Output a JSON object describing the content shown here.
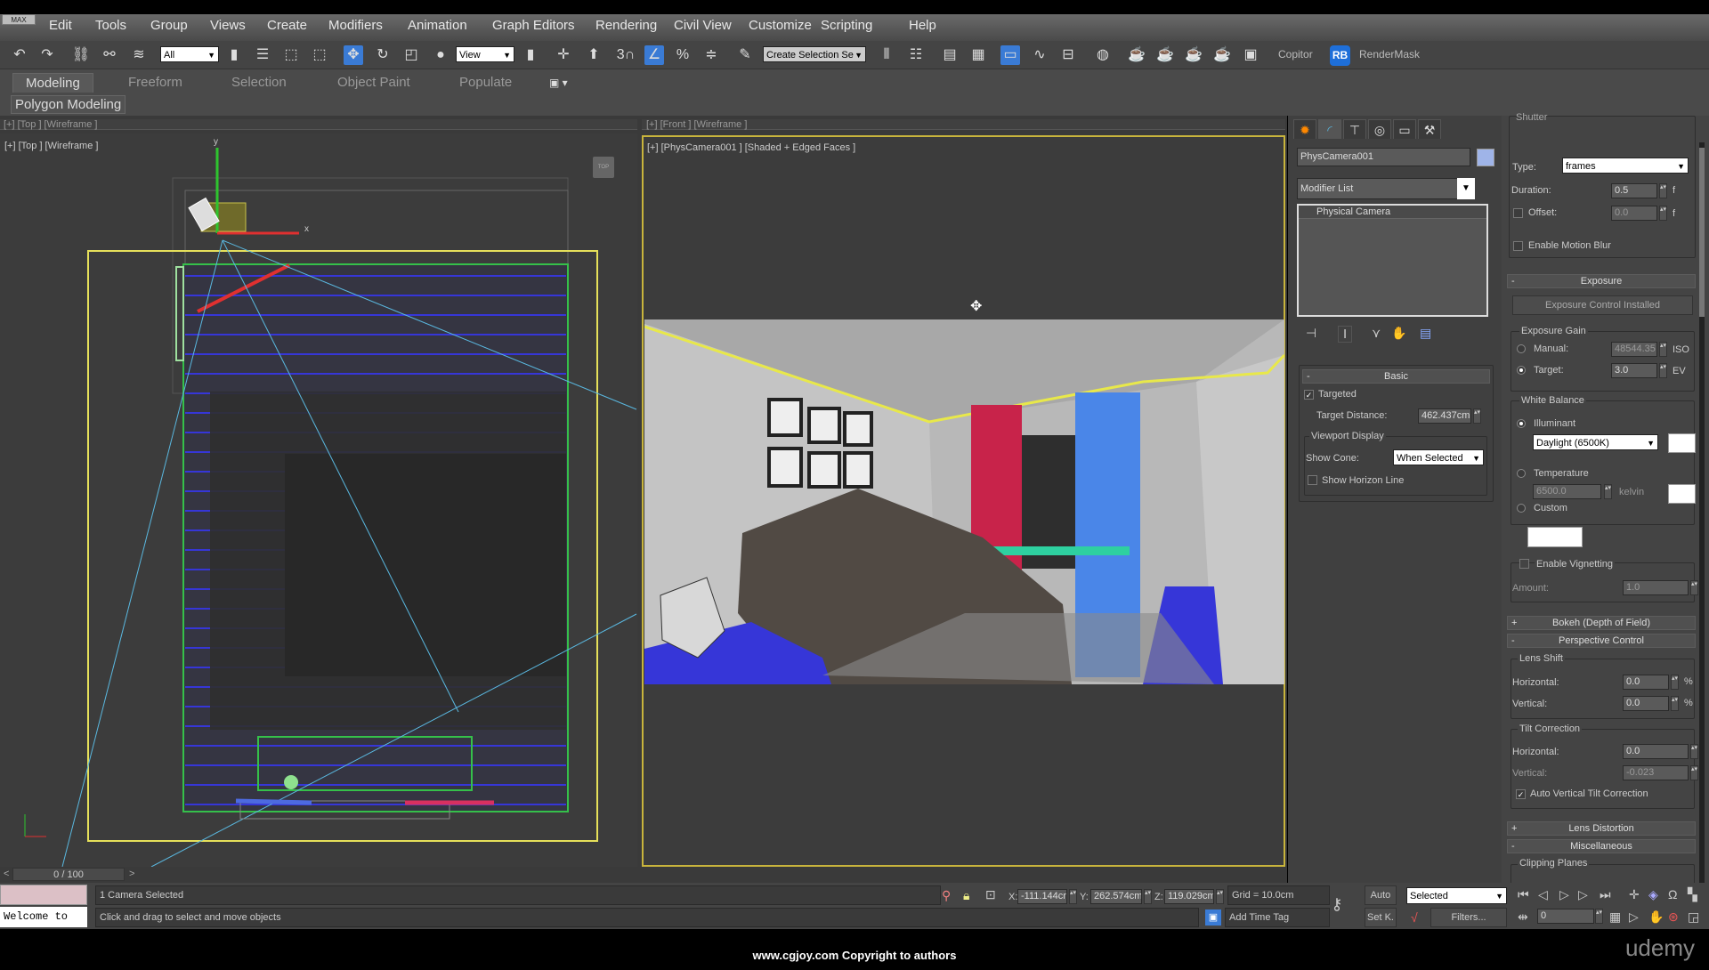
{
  "app": {
    "max_button": "MAX"
  },
  "menu": [
    "Edit",
    "Tools",
    "Group",
    "Views",
    "Create",
    "Modifiers",
    "Animation",
    "Graph Editors",
    "Rendering",
    "Civil View",
    "Customize",
    "Scripting",
    "Help"
  ],
  "toolbar": {
    "selection_filter": "All",
    "reference_coord": "View",
    "named_selection": "Create Selection Se",
    "snap_3": "3",
    "copitor": "Copitor",
    "rb_logo": "RB",
    "rendermask": "RenderMask"
  },
  "ribbon": {
    "tabs": [
      "Modeling",
      "Freeform",
      "Selection",
      "Object Paint",
      "Populate"
    ],
    "active": "Modeling",
    "panel": "Polygon Modeling"
  },
  "viewports": {
    "top_mini_label": "[+] [Top ] [Wireframe ]",
    "front_mini_label": "[+] [Front ] [Wireframe ]",
    "left_label": "[+] [Top ] [Wireframe ]",
    "right_label": "[+] [PhysCamera001 ] [Shaded + Edged Faces ]",
    "axis_x": "x",
    "axis_y": "y"
  },
  "command_panel": {
    "object_name": "PhysCamera001",
    "object_color": "#9fb4e8",
    "modifier_list": "Modifier List",
    "stack": [
      "Physical Camera"
    ],
    "basic": {
      "header": "Basic",
      "targeted": "Targeted",
      "targeted_checked": true,
      "target_distance_label": "Target Distance:",
      "target_distance": "462.437cm",
      "viewport_display": "Viewport Display",
      "show_cone_label": "Show Cone:",
      "show_cone": "When Selected",
      "show_horizon": "Show Horizon Line",
      "show_horizon_checked": false
    },
    "shutter": {
      "header": "Shutter",
      "type_label": "Type:",
      "type": "frames",
      "duration_label": "Duration:",
      "duration": "0.5",
      "duration_unit": "f",
      "offset_label": "Offset:",
      "offset": "0.0",
      "offset_unit": "f",
      "motion_blur": "Enable Motion Blur"
    },
    "exposure": {
      "header": "Exposure",
      "control_button": "Exposure Control Installed",
      "gain_group": "Exposure Gain",
      "manual_label": "Manual:",
      "manual": "48544.35",
      "manual_unit": "ISO",
      "target_label": "Target:",
      "target": "3.0",
      "target_unit": "EV",
      "white_balance": "White Balance",
      "illuminant": "Illuminant",
      "illuminant_value": "Daylight (6500K)",
      "temperature": "Temperature",
      "temperature_value": "6500.0",
      "temperature_unit": "kelvin",
      "custom": "Custom",
      "vignetting": "Enable Vignetting",
      "amount_label": "Amount:",
      "amount": "1.0"
    },
    "bokeh": {
      "header": "Bokeh (Depth of Field)"
    },
    "perspective": {
      "header": "Perspective Control",
      "lens_shift": "Lens Shift",
      "h_label": "Horizontal:",
      "h": "0.0",
      "v_label": "Vertical:",
      "v": "0.0",
      "unit": "%",
      "tilt": "Tilt Correction",
      "th_label": "Horizontal:",
      "th": "0.0",
      "tv_label": "Vertical:",
      "tv": "-0.023",
      "auto_tilt": "Auto Vertical Tilt Correction"
    },
    "lens_distortion": {
      "header": "Lens Distortion"
    },
    "misc": {
      "header": "Miscellaneous",
      "clipping": "Clipping Planes"
    }
  },
  "timeline": {
    "prev": "<",
    "frame": "0 / 100",
    "next": ">"
  },
  "status": {
    "welcome": "Welcome to",
    "selection": "1 Camera Selected",
    "prompt": "Click and drag to select and move objects",
    "x_label": "X:",
    "x": "-111.144cm",
    "y_label": "Y:",
    "y": "262.574cm",
    "z_label": "Z:",
    "z": "119.029cm",
    "grid": "Grid = 10.0cm",
    "add_time_tag": "Add Time Tag",
    "auto": "Auto",
    "set_key": "Set K.",
    "key_filter": "Selected",
    "filters": "Filters...",
    "current_frame": "0"
  },
  "watermark": "www.cgjoy.com Copyright to authors",
  "udemy": "udemy"
}
